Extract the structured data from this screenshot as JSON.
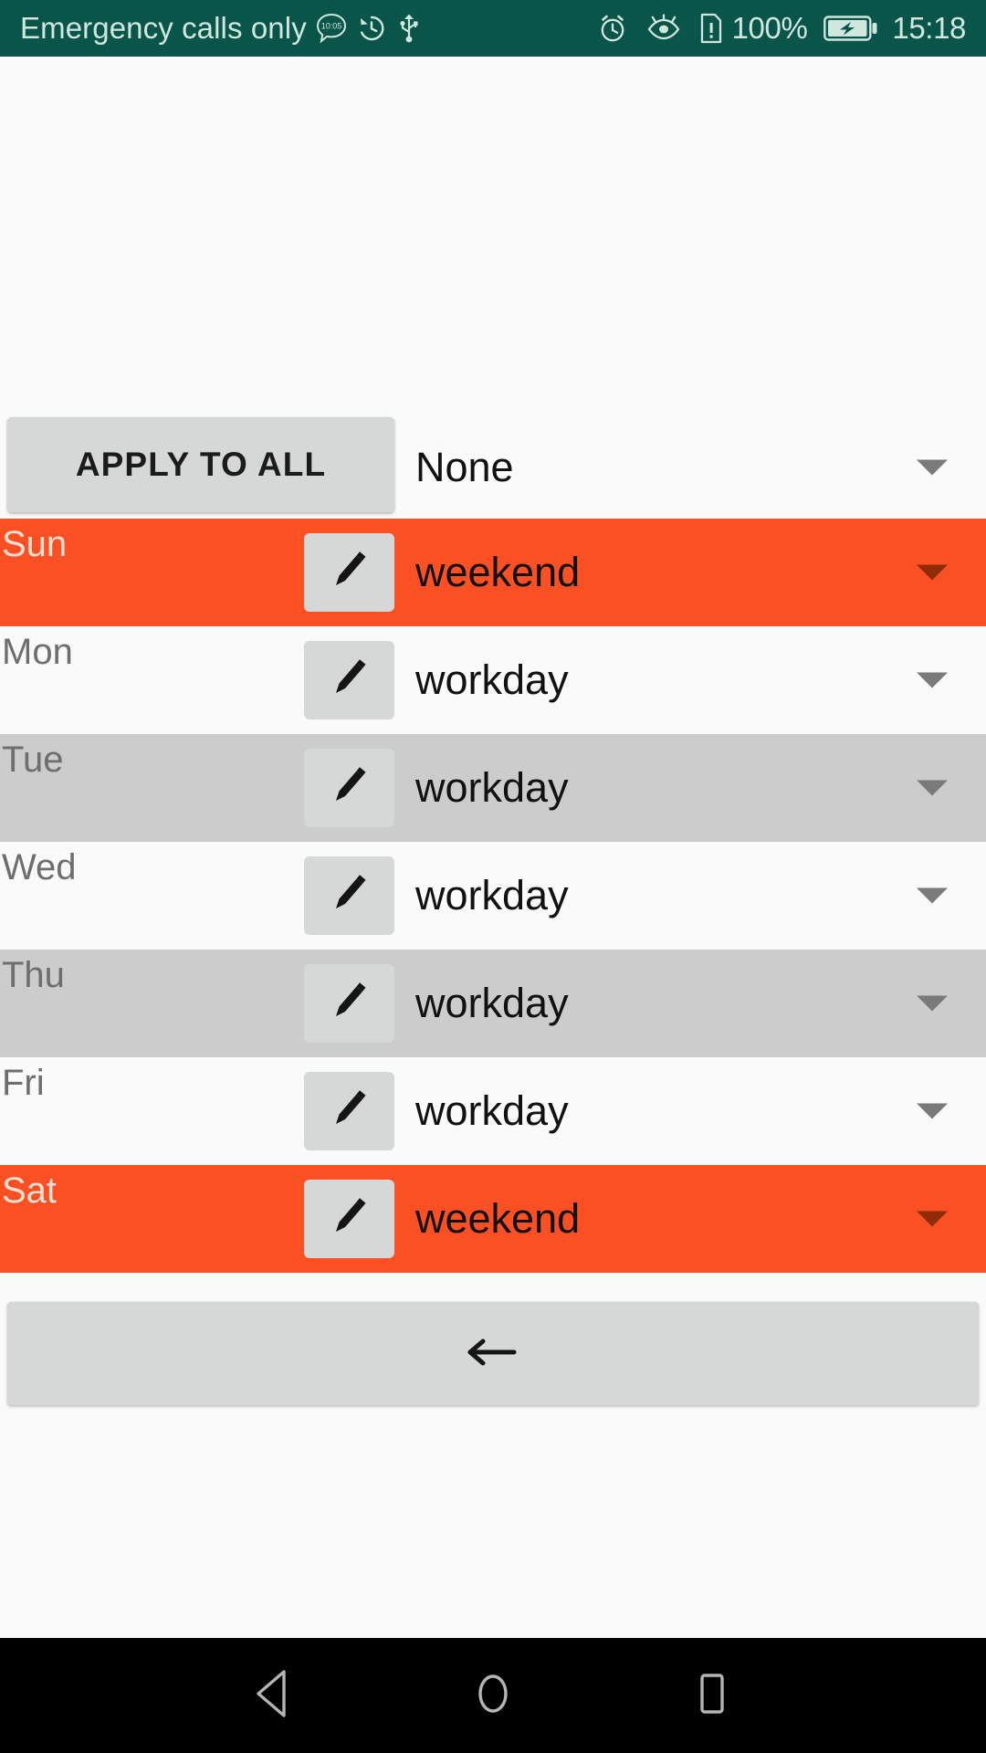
{
  "status_bar": {
    "carrier": "Emergency calls only",
    "left_icons": [
      {
        "name": "message-bubble-icon",
        "label": "10:05"
      },
      {
        "name": "history-clock-icon"
      },
      {
        "name": "usb-icon"
      }
    ],
    "right_icons": [
      {
        "name": "alarm-clock-icon"
      },
      {
        "name": "eye-comfort-icon"
      },
      {
        "name": "sim-alert-icon"
      }
    ],
    "battery_percent": "100%",
    "battery_state": "charging",
    "clock": "15:18",
    "background_color": "#0A5549",
    "foreground_color": "#CFE7DF"
  },
  "apply_row": {
    "button_label": "APPLY TO ALL",
    "spinner_value": "None",
    "spinner_icon": "chevron-down-icon"
  },
  "days": [
    {
      "abbr": "Sun",
      "type": "weekend",
      "style": "highlight",
      "edit_icon": "pencil-icon",
      "spinner_icon": "chevron-down-icon"
    },
    {
      "abbr": "Mon",
      "type": "workday",
      "style": "plain",
      "edit_icon": "pencil-icon",
      "spinner_icon": "chevron-down-icon"
    },
    {
      "abbr": "Tue",
      "type": "workday",
      "style": "alt",
      "edit_icon": "pencil-icon",
      "spinner_icon": "chevron-down-icon"
    },
    {
      "abbr": "Wed",
      "type": "workday",
      "style": "plain",
      "edit_icon": "pencil-icon",
      "spinner_icon": "chevron-down-icon"
    },
    {
      "abbr": "Thu",
      "type": "workday",
      "style": "alt",
      "edit_icon": "pencil-icon",
      "spinner_icon": "chevron-down-icon"
    },
    {
      "abbr": "Fri",
      "type": "workday",
      "style": "plain",
      "edit_icon": "pencil-icon",
      "spinner_icon": "chevron-down-icon"
    },
    {
      "abbr": "Sat",
      "type": "weekend",
      "style": "highlight",
      "edit_icon": "pencil-icon",
      "spinner_icon": "chevron-down-icon"
    }
  ],
  "back_button": {
    "icon": "arrow-left-icon"
  },
  "nav_bar": {
    "back": "triangle-back-icon",
    "home": "circle-home-icon",
    "recents": "square-recents-icon"
  },
  "colors": {
    "status_bar": "#0A5549",
    "highlight_row": "#FA5023",
    "alt_row": "#CCCCCC",
    "plain_row": "#FAFAFA",
    "button_face": "#D6D7D7",
    "nav_bar": "#000000"
  }
}
